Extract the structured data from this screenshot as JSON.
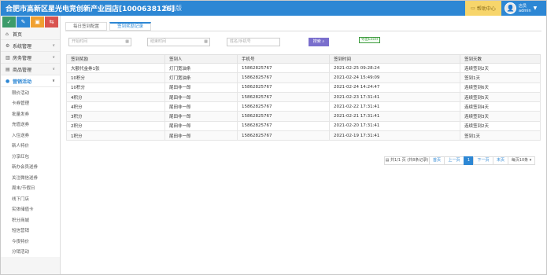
{
  "header": {
    "title": "合肥市高新区星光电竞创新产业园店[1000638126]",
    "version": "连锁版",
    "help_label": "帮助中心",
    "user_role": "店员",
    "user_name": "admin"
  },
  "sidebar": {
    "quick_buttons": [
      {
        "icon": "check-icon",
        "color": "#3c9b6a"
      },
      {
        "icon": "pencil-icon",
        "color": "#2d87d4"
      },
      {
        "icon": "calendar-icon",
        "color": "#f0a030"
      },
      {
        "icon": "share-icon",
        "color": "#d9534f"
      }
    ],
    "menu": [
      {
        "label": "首页",
        "icon": "home-icon",
        "chevron": false
      },
      {
        "label": "系统管理",
        "icon": "gear-icon",
        "chevron": true
      },
      {
        "label": "房务管理",
        "icon": "bank-icon",
        "chevron": true
      },
      {
        "label": "商品管理",
        "icon": "box-icon",
        "chevron": true
      },
      {
        "label": "营销活动",
        "icon": "info-icon",
        "chevron": true,
        "active": true
      }
    ],
    "submenu": [
      "限价活动",
      "卡券管理",
      "批量发券",
      "充值送券",
      "入住送券",
      "新人特价",
      "分享红包",
      "新办会员送券",
      "关注微信送券",
      "周末/节假日",
      "线下门店",
      "实体储值卡",
      "积分商城",
      "短信营销",
      "今夜特价",
      "分销活动"
    ]
  },
  "tabs": [
    {
      "label": "每日签到配置",
      "active": false
    },
    {
      "label": "签到奖励记录",
      "active": true
    }
  ],
  "filters": {
    "start_placeholder": "开始时间",
    "end_placeholder": "结束时间",
    "name_placeholder": "姓名/手机号",
    "search_label": "搜索",
    "export_label": "导出Excel"
  },
  "table": {
    "columns": [
      "签到奖励",
      "签到人",
      "手机号",
      "签到时间",
      "签到天数"
    ],
    "rows": [
      [
        "大额代金券1张",
        "灯门宽油条",
        "15862825767",
        "2021-02-25 09:28:24",
        "连续签到2天"
      ],
      [
        "10积分",
        "灯门宽油条",
        "15862825767",
        "2021-02-24 15:49:09",
        "签到1天"
      ],
      [
        "10积分",
        "尾田非一郎",
        "15862825767",
        "2021-02-24 14:24:47",
        "连续签到6天"
      ],
      [
        "4积分",
        "尾田非一郎",
        "15862825767",
        "2021-02-23 17:31:41",
        "连续签到5天"
      ],
      [
        "4积分",
        "尾田非一郎",
        "15862825767",
        "2021-02-22 17:31:41",
        "连续签到4天"
      ],
      [
        "3积分",
        "尾田非一郎",
        "15862825767",
        "2021-02-21 17:31:41",
        "连续签到3天"
      ],
      [
        "2积分",
        "尾田非一郎",
        "15862825767",
        "2021-02-20 17:31:41",
        "连续签到2天"
      ],
      [
        "1积分",
        "尾田非一郎",
        "15862825767",
        "2021-02-19 17:31:41",
        "签到1天"
      ]
    ]
  },
  "pager": {
    "info": "共1/1 页 (共8条记录)",
    "first": "首页",
    "prev": "上一页",
    "current": "1",
    "next": "下一页",
    "last": "末页",
    "page_size": "每页10条 ▾"
  }
}
